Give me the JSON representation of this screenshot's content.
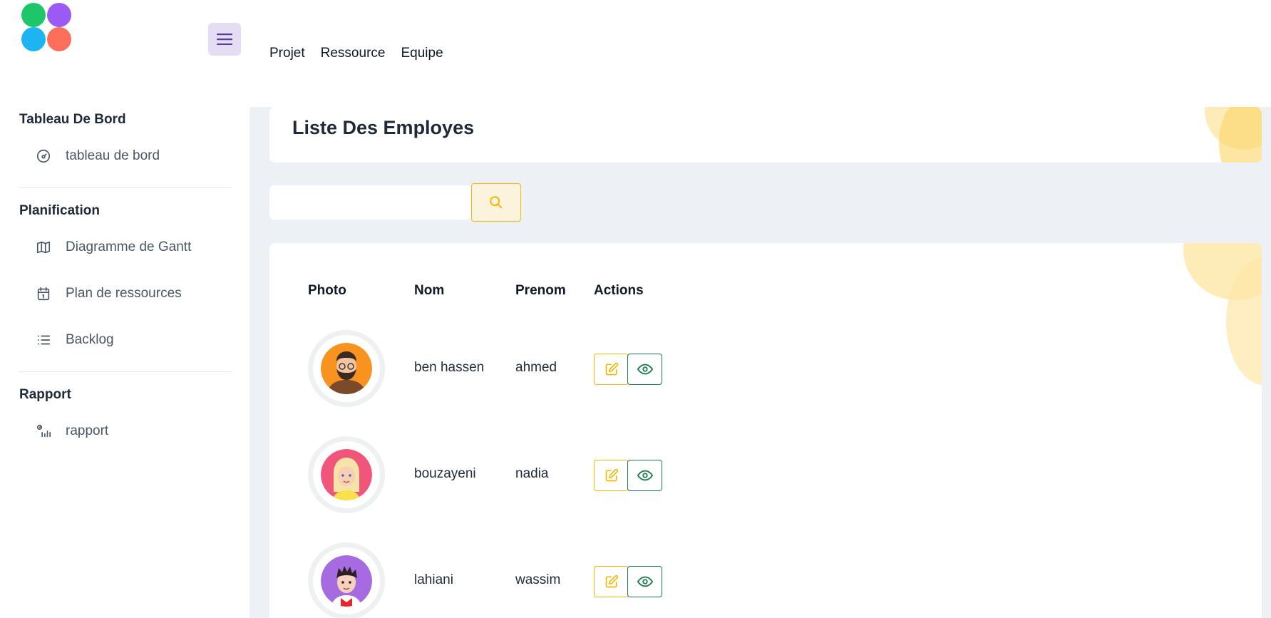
{
  "header": {
    "nav": [
      {
        "label": "Projet"
      },
      {
        "label": "Ressource"
      },
      {
        "label": "Equipe"
      }
    ]
  },
  "colors": {
    "logo": [
      "#1ec66a",
      "#9b59f5",
      "#1cb5f2",
      "#fb6f5b"
    ],
    "accent_yellow": "#f0b90b",
    "accent_green": "#1f7a4d",
    "menu_bg": "#e5ddf3"
  },
  "sidebar": {
    "sections": [
      {
        "title": "Tableau De Bord",
        "items": [
          {
            "label": "tableau de bord",
            "icon": "gauge-icon"
          }
        ]
      },
      {
        "title": "Planification",
        "items": [
          {
            "label": "Diagramme de Gantt",
            "icon": "map-icon"
          },
          {
            "label": "Plan de ressources",
            "icon": "calendar-icon"
          },
          {
            "label": "Backlog",
            "icon": "list-icon"
          }
        ]
      },
      {
        "title": "Rapport",
        "items": [
          {
            "label": "rapport",
            "icon": "report-chart-icon"
          }
        ]
      }
    ]
  },
  "main": {
    "title": "Liste Des Employes",
    "search": {
      "placeholder": "",
      "value": ""
    },
    "table": {
      "headers": [
        "Photo",
        "Nom",
        "Prenom",
        "Actions"
      ],
      "rows": [
        {
          "nom": "ben hassen",
          "prenom": "ahmed",
          "avatar": "man-bearded-avatar"
        },
        {
          "nom": "bouzayeni",
          "prenom": "nadia",
          "avatar": "woman-blonde-avatar"
        },
        {
          "nom": "lahiani",
          "prenom": "wassim",
          "avatar": "man-young-avatar"
        }
      ]
    }
  }
}
